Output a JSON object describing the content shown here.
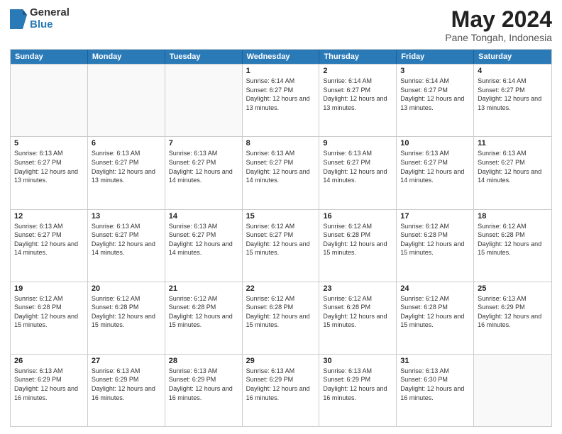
{
  "logo": {
    "general": "General",
    "blue": "Blue"
  },
  "title": {
    "month": "May 2024",
    "location": "Pane Tongah, Indonesia"
  },
  "header_days": [
    "Sunday",
    "Monday",
    "Tuesday",
    "Wednesday",
    "Thursday",
    "Friday",
    "Saturday"
  ],
  "weeks": [
    [
      {
        "day": "",
        "sunrise": "",
        "sunset": "",
        "daylight": "",
        "empty": true
      },
      {
        "day": "",
        "sunrise": "",
        "sunset": "",
        "daylight": "",
        "empty": true
      },
      {
        "day": "",
        "sunrise": "",
        "sunset": "",
        "daylight": "",
        "empty": true
      },
      {
        "day": "1",
        "sunrise": "Sunrise: 6:14 AM",
        "sunset": "Sunset: 6:27 PM",
        "daylight": "Daylight: 12 hours and 13 minutes.",
        "empty": false
      },
      {
        "day": "2",
        "sunrise": "Sunrise: 6:14 AM",
        "sunset": "Sunset: 6:27 PM",
        "daylight": "Daylight: 12 hours and 13 minutes.",
        "empty": false
      },
      {
        "day": "3",
        "sunrise": "Sunrise: 6:14 AM",
        "sunset": "Sunset: 6:27 PM",
        "daylight": "Daylight: 12 hours and 13 minutes.",
        "empty": false
      },
      {
        "day": "4",
        "sunrise": "Sunrise: 6:14 AM",
        "sunset": "Sunset: 6:27 PM",
        "daylight": "Daylight: 12 hours and 13 minutes.",
        "empty": false
      }
    ],
    [
      {
        "day": "5",
        "sunrise": "Sunrise: 6:13 AM",
        "sunset": "Sunset: 6:27 PM",
        "daylight": "Daylight: 12 hours and 13 minutes.",
        "empty": false
      },
      {
        "day": "6",
        "sunrise": "Sunrise: 6:13 AM",
        "sunset": "Sunset: 6:27 PM",
        "daylight": "Daylight: 12 hours and 13 minutes.",
        "empty": false
      },
      {
        "day": "7",
        "sunrise": "Sunrise: 6:13 AM",
        "sunset": "Sunset: 6:27 PM",
        "daylight": "Daylight: 12 hours and 14 minutes.",
        "empty": false
      },
      {
        "day": "8",
        "sunrise": "Sunrise: 6:13 AM",
        "sunset": "Sunset: 6:27 PM",
        "daylight": "Daylight: 12 hours and 14 minutes.",
        "empty": false
      },
      {
        "day": "9",
        "sunrise": "Sunrise: 6:13 AM",
        "sunset": "Sunset: 6:27 PM",
        "daylight": "Daylight: 12 hours and 14 minutes.",
        "empty": false
      },
      {
        "day": "10",
        "sunrise": "Sunrise: 6:13 AM",
        "sunset": "Sunset: 6:27 PM",
        "daylight": "Daylight: 12 hours and 14 minutes.",
        "empty": false
      },
      {
        "day": "11",
        "sunrise": "Sunrise: 6:13 AM",
        "sunset": "Sunset: 6:27 PM",
        "daylight": "Daylight: 12 hours and 14 minutes.",
        "empty": false
      }
    ],
    [
      {
        "day": "12",
        "sunrise": "Sunrise: 6:13 AM",
        "sunset": "Sunset: 6:27 PM",
        "daylight": "Daylight: 12 hours and 14 minutes.",
        "empty": false
      },
      {
        "day": "13",
        "sunrise": "Sunrise: 6:13 AM",
        "sunset": "Sunset: 6:27 PM",
        "daylight": "Daylight: 12 hours and 14 minutes.",
        "empty": false
      },
      {
        "day": "14",
        "sunrise": "Sunrise: 6:13 AM",
        "sunset": "Sunset: 6:27 PM",
        "daylight": "Daylight: 12 hours and 14 minutes.",
        "empty": false
      },
      {
        "day": "15",
        "sunrise": "Sunrise: 6:12 AM",
        "sunset": "Sunset: 6:27 PM",
        "daylight": "Daylight: 12 hours and 15 minutes.",
        "empty": false
      },
      {
        "day": "16",
        "sunrise": "Sunrise: 6:12 AM",
        "sunset": "Sunset: 6:28 PM",
        "daylight": "Daylight: 12 hours and 15 minutes.",
        "empty": false
      },
      {
        "day": "17",
        "sunrise": "Sunrise: 6:12 AM",
        "sunset": "Sunset: 6:28 PM",
        "daylight": "Daylight: 12 hours and 15 minutes.",
        "empty": false
      },
      {
        "day": "18",
        "sunrise": "Sunrise: 6:12 AM",
        "sunset": "Sunset: 6:28 PM",
        "daylight": "Daylight: 12 hours and 15 minutes.",
        "empty": false
      }
    ],
    [
      {
        "day": "19",
        "sunrise": "Sunrise: 6:12 AM",
        "sunset": "Sunset: 6:28 PM",
        "daylight": "Daylight: 12 hours and 15 minutes.",
        "empty": false
      },
      {
        "day": "20",
        "sunrise": "Sunrise: 6:12 AM",
        "sunset": "Sunset: 6:28 PM",
        "daylight": "Daylight: 12 hours and 15 minutes.",
        "empty": false
      },
      {
        "day": "21",
        "sunrise": "Sunrise: 6:12 AM",
        "sunset": "Sunset: 6:28 PM",
        "daylight": "Daylight: 12 hours and 15 minutes.",
        "empty": false
      },
      {
        "day": "22",
        "sunrise": "Sunrise: 6:12 AM",
        "sunset": "Sunset: 6:28 PM",
        "daylight": "Daylight: 12 hours and 15 minutes.",
        "empty": false
      },
      {
        "day": "23",
        "sunrise": "Sunrise: 6:12 AM",
        "sunset": "Sunset: 6:28 PM",
        "daylight": "Daylight: 12 hours and 15 minutes.",
        "empty": false
      },
      {
        "day": "24",
        "sunrise": "Sunrise: 6:12 AM",
        "sunset": "Sunset: 6:28 PM",
        "daylight": "Daylight: 12 hours and 15 minutes.",
        "empty": false
      },
      {
        "day": "25",
        "sunrise": "Sunrise: 6:13 AM",
        "sunset": "Sunset: 6:29 PM",
        "daylight": "Daylight: 12 hours and 16 minutes.",
        "empty": false
      }
    ],
    [
      {
        "day": "26",
        "sunrise": "Sunrise: 6:13 AM",
        "sunset": "Sunset: 6:29 PM",
        "daylight": "Daylight: 12 hours and 16 minutes.",
        "empty": false
      },
      {
        "day": "27",
        "sunrise": "Sunrise: 6:13 AM",
        "sunset": "Sunset: 6:29 PM",
        "daylight": "Daylight: 12 hours and 16 minutes.",
        "empty": false
      },
      {
        "day": "28",
        "sunrise": "Sunrise: 6:13 AM",
        "sunset": "Sunset: 6:29 PM",
        "daylight": "Daylight: 12 hours and 16 minutes.",
        "empty": false
      },
      {
        "day": "29",
        "sunrise": "Sunrise: 6:13 AM",
        "sunset": "Sunset: 6:29 PM",
        "daylight": "Daylight: 12 hours and 16 minutes.",
        "empty": false
      },
      {
        "day": "30",
        "sunrise": "Sunrise: 6:13 AM",
        "sunset": "Sunset: 6:29 PM",
        "daylight": "Daylight: 12 hours and 16 minutes.",
        "empty": false
      },
      {
        "day": "31",
        "sunrise": "Sunrise: 6:13 AM",
        "sunset": "Sunset: 6:30 PM",
        "daylight": "Daylight: 12 hours and 16 minutes.",
        "empty": false
      },
      {
        "day": "",
        "sunrise": "",
        "sunset": "",
        "daylight": "",
        "empty": true
      }
    ]
  ]
}
